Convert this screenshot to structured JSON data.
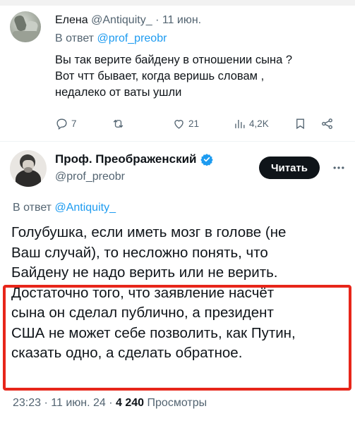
{
  "reply": {
    "name": "Елена",
    "handle": "@Antiquity_",
    "separator": "·",
    "date": "11 июн.",
    "in_reply_prefix": "В ответ",
    "in_reply_mention": "@prof_preobr",
    "text_lines": [
      "Вы так верите байдену в отношении сына ?",
      "Вот чтт бывает, когда веришь словам ,",
      "недалеко от ваты ушли"
    ],
    "actions": {
      "replies": "7",
      "retweets": "",
      "likes": "21",
      "views": "4,2K"
    },
    "icons": [
      "reply-icon",
      "retweet-icon",
      "like-icon",
      "views-icon",
      "bookmark-icon",
      "share-icon"
    ]
  },
  "main": {
    "name": "Проф. Преображенский",
    "handle": "@prof_preobr",
    "read_button": "Читать",
    "in_reply_prefix": "В ответ",
    "in_reply_mention": "@Antiquity_",
    "text_lines": [
      "Голубушка, если иметь мозг в голове (не",
      "Ваш случай), то несложно понять, что",
      "Байдену не надо верить или не верить.",
      "Достаточно того, что заявление насчёт",
      "сына он сделал публично, а президент",
      "США не может себе позволить, как Путин,",
      "сказать одно, а сделать обратное."
    ],
    "time": "23:23",
    "separator": "·",
    "date": "11 июн. 24",
    "views_count": "4 240",
    "views_label": "Просмотры"
  },
  "colors": {
    "accent": "#1d9bf0",
    "secondary_text": "#536471",
    "highlight_border": "#e7261a",
    "button_bg": "#0f1419"
  }
}
